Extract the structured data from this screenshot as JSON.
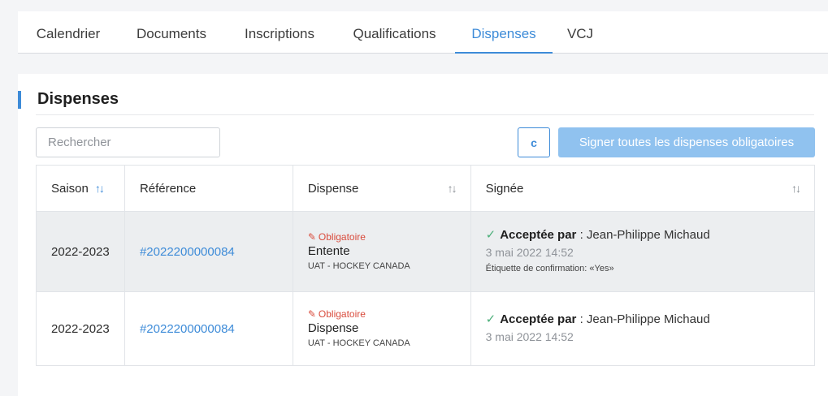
{
  "tabs": [
    {
      "label": "Calendrier",
      "active": false
    },
    {
      "label": "Documents",
      "active": false
    },
    {
      "label": "Inscriptions",
      "active": false
    },
    {
      "label": "Qualifications",
      "active": false
    },
    {
      "label": "Dispenses",
      "active": true
    },
    {
      "label": "VCJ",
      "active": false
    }
  ],
  "panel": {
    "title": "Dispenses",
    "search_placeholder": "Rechercher",
    "refresh_icon": "c",
    "sign_all_label": "Signer toutes les dispenses obligatoires"
  },
  "table": {
    "headers": {
      "saison": "Saison",
      "reference": "Référence",
      "dispense": "Dispense",
      "signee": "Signée",
      "sort_icon": "↑↓"
    },
    "rows": [
      {
        "saison": "2022-2023",
        "reference": "#2022200000084",
        "mandatory": "Obligatoire",
        "dispense_name": "Entente",
        "organization": "UAT - HOCKEY CANADA",
        "accepted_label": "Acceptée par",
        "accepted_by": " : Jean-Philippe Michaud",
        "date": "3 mai 2022 14:52",
        "confirmation": "Étiquette de confirmation: «Yes»"
      },
      {
        "saison": "2022-2023",
        "reference": "#2022200000084",
        "mandatory": "Obligatoire",
        "dispense_name": "Dispense",
        "organization": "UAT - HOCKEY CANADA",
        "accepted_label": "Acceptée par",
        "accepted_by": " : Jean-Philippe Michaud",
        "date": "3 mai 2022 14:52",
        "confirmation": ""
      }
    ]
  },
  "colors": {
    "accent": "#3d8bd8",
    "mandatory": "#d94b3c",
    "check": "#4caf7a",
    "button_disabled": "#90c2ef"
  }
}
